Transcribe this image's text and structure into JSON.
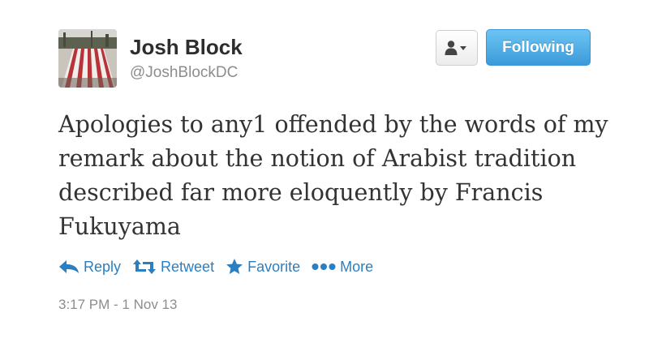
{
  "user": {
    "name": "Josh Block",
    "handle": "@JoshBlockDC",
    "avatar_icon": "flag-photo-avatar"
  },
  "header": {
    "user_dropdown_icon": "person-dropdown-icon",
    "follow_label": "Following"
  },
  "tweet": {
    "text": "Apologies to any1 offended by the words of my remark about the notion of Arabist tradition described far more eloquently by Francis Fukuyama",
    "timestamp": "3:17 PM - 1 Nov 13"
  },
  "actions": {
    "reply": "Reply",
    "retweet": "Retweet",
    "favorite": "Favorite",
    "more": "More"
  },
  "colors": {
    "link": "#2a7fc2",
    "follow_button": "#3b9ad9",
    "muted_text": "#8d8d8d",
    "name_text": "#2d2d2d"
  }
}
